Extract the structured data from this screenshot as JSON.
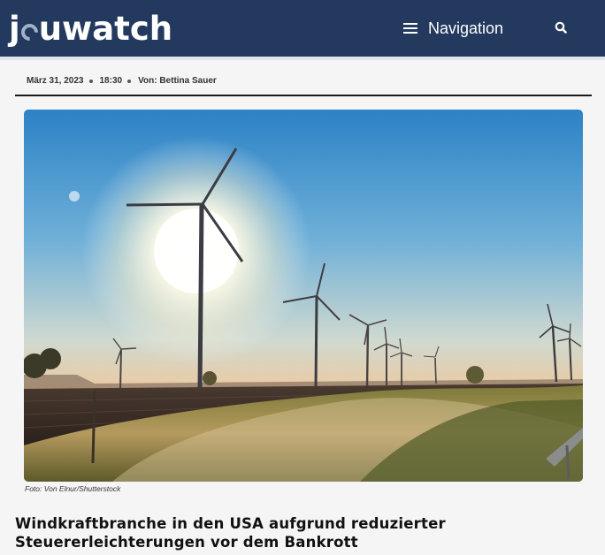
{
  "header": {
    "logo_text": "jouwatch",
    "nav_label": "Navigation",
    "nav_icon": "hamburger-icon",
    "search_icon": "search-icon"
  },
  "article": {
    "date": "März 31, 2023",
    "time": "18:30",
    "author": "Von: Bettina Sauer",
    "image_caption": "Foto: Von Elnur/Shutterstock",
    "headline": "Windkraftbranche in den USA aufgrund reduzierter Steuererleichterungen vor dem Bankrott"
  },
  "colors": {
    "header_bg": "#233a5e",
    "sky_top": "#2f86c8",
    "sky_horizon": "#f6c08a"
  }
}
